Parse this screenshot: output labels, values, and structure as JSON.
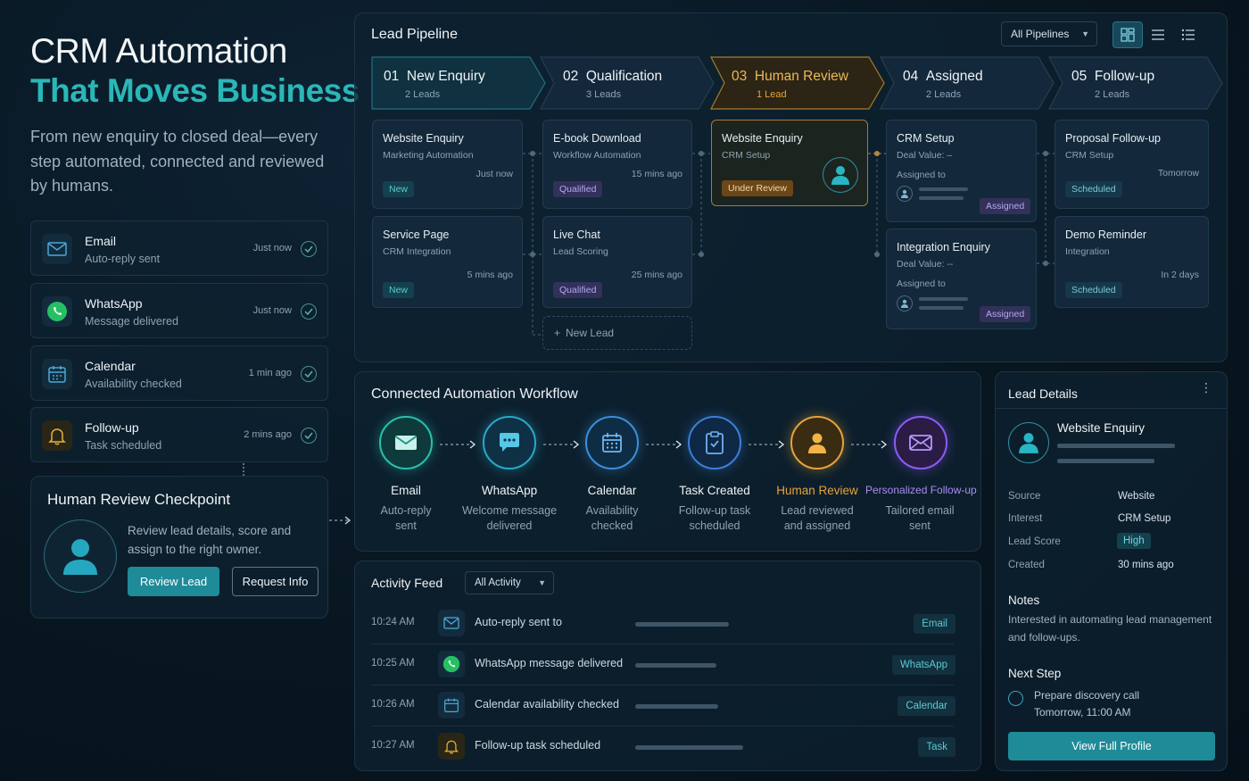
{
  "hero": {
    "title_line1": "CRM Automation",
    "title_line2": "That Moves Business",
    "subtitle": "From new enquiry to closed deal—every step automated, connected and reviewed by humans."
  },
  "notifications": [
    {
      "title": "Email",
      "subtitle": "Auto-reply sent",
      "time": "Just now",
      "icon": "mail-icon"
    },
    {
      "title": "WhatsApp",
      "subtitle": "Message delivered",
      "time": "Just now",
      "icon": "whatsapp-icon"
    },
    {
      "title": "Calendar",
      "subtitle": "Availability checked",
      "time": "1 min ago",
      "icon": "calendar-icon"
    },
    {
      "title": "Follow-up",
      "subtitle": "Task scheduled",
      "time": "2 mins ago",
      "icon": "bell-icon"
    }
  ],
  "checkpoint": {
    "title": "Human Review Checkpoint",
    "description": "Review lead details, score and assign to the right owner.",
    "primary_button": "Review Lead",
    "secondary_button": "Request Info"
  },
  "pipeline": {
    "title": "Lead Pipeline",
    "filter": "All Pipelines",
    "stages": [
      {
        "num": "01",
        "name": "New Enquiry",
        "count": "2 Leads"
      },
      {
        "num": "02",
        "name": "Qualification",
        "count": "3 Leads"
      },
      {
        "num": "03",
        "name": "Human Review",
        "count": "1 Lead"
      },
      {
        "num": "04",
        "name": "Assigned",
        "count": "2 Leads"
      },
      {
        "num": "05",
        "name": "Follow-up",
        "count": "2 Leads"
      }
    ],
    "cards": {
      "c1": {
        "title": "Website Enquiry",
        "sub": "Marketing Automation",
        "time": "Just now",
        "badge": "New"
      },
      "c2": {
        "title": "Service Page",
        "sub": "CRM Integration",
        "time": "5 mins ago",
        "badge": "New"
      },
      "c3": {
        "title": "E-book Download",
        "sub": "Workflow Automation",
        "time": "15 mins ago",
        "badge": "Qualified"
      },
      "c4": {
        "title": "Live Chat",
        "sub": "Lead Scoring",
        "time": "25 mins ago",
        "badge": "Qualified"
      },
      "c5": {
        "title": "Website Enquiry",
        "sub": "CRM Setup",
        "badge": "Under Review"
      },
      "c6": {
        "title": "CRM Setup",
        "sub": "Deal Value: –",
        "assigned": "Assigned to",
        "badge": "Assigned"
      },
      "c7": {
        "title": "Integration Enquiry",
        "sub": "Deal Value: --",
        "assigned": "Assigned to",
        "badge": "Assigned"
      },
      "c8": {
        "title": "Proposal Follow-up",
        "sub": "CRM Setup",
        "time": "Tomorrow",
        "badge": "Scheduled"
      },
      "c9": {
        "title": "Demo Reminder",
        "sub": "Integration",
        "time": "In 2 days",
        "badge": "Scheduled"
      }
    },
    "new_lead": "New Lead"
  },
  "workflow": {
    "title": "Connected Automation Workflow",
    "steps": [
      {
        "label": "Email",
        "desc": "Auto-reply sent",
        "icon": "mail-icon"
      },
      {
        "label": "WhatsApp",
        "desc": "Welcome message delivered",
        "icon": "chat-icon"
      },
      {
        "label": "Calendar",
        "desc": "Availability checked",
        "icon": "calendar-icon"
      },
      {
        "label": "Task Created",
        "desc": "Follow-up task scheduled",
        "icon": "clipboard-icon"
      },
      {
        "label": "Human Review",
        "desc": "Lead reviewed and assigned",
        "icon": "user-icon"
      },
      {
        "label": "Personalized Follow-up",
        "desc": "Tailored email sent",
        "icon": "mail-icon"
      }
    ]
  },
  "activity": {
    "title": "Activity Feed",
    "filter": "All Activity",
    "rows": [
      {
        "time": "10:24 AM",
        "text": "Auto-reply sent to",
        "tag": "Email",
        "bar": 0.6
      },
      {
        "time": "10:25 AM",
        "text": "WhatsApp message delivered",
        "tag": "WhatsApp",
        "bar": 0.52
      },
      {
        "time": "10:26 AM",
        "text": "Calendar availability checked",
        "tag": "Calendar",
        "bar": 0.53
      },
      {
        "time": "10:27 AM",
        "text": "Follow-up task scheduled",
        "tag": "Task",
        "bar": 0.69
      }
    ]
  },
  "lead_details": {
    "title": "Lead Details",
    "name": "Website Enquiry",
    "fields": [
      {
        "key": "Source",
        "value": "Website"
      },
      {
        "key": "Interest",
        "value": "CRM Setup"
      },
      {
        "key": "Lead Score",
        "value": "High"
      },
      {
        "key": "Created",
        "value": "30 mins ago"
      }
    ],
    "notes_title": "Notes",
    "notes": "Interested in automating lead management and follow-ups.",
    "next_step_title": "Next Step",
    "next_step_line1": "Prepare discovery call",
    "next_step_line2": "Tomorrow, 11:00 AM",
    "button": "View Full Profile"
  },
  "colors": {
    "accent": "#2ab7b8",
    "amber": "#e6a33a",
    "purple": "#8b5cf6",
    "primary_button": "#1f8b98"
  }
}
